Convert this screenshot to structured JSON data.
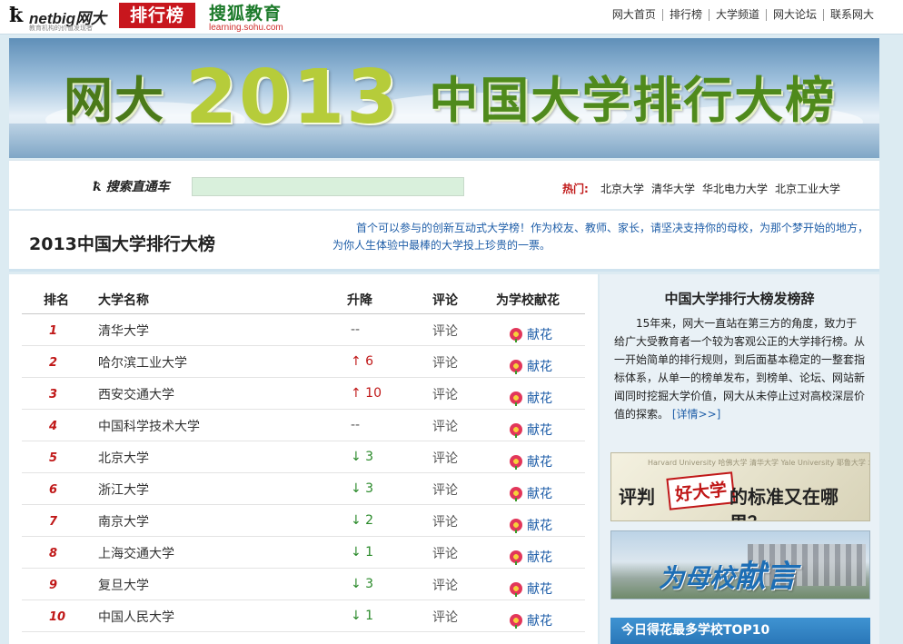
{
  "header": {
    "netbig_brand": "netbig网大",
    "netbig_slogan": "教育机构的价值发现者",
    "ranking_badge": "排行榜",
    "sohu_title": "搜狐教育",
    "sohu_url": "learning.sohu.com",
    "nav": [
      "网大首页",
      "排行榜",
      "大学频道",
      "网大论坛",
      "联系网大"
    ]
  },
  "banner": {
    "prefix": "网大",
    "year": "2013",
    "suffix": "中国大学排行大榜"
  },
  "search": {
    "label": "搜索直通车",
    "value": "",
    "hot_label": "热门:",
    "hot": [
      "北京大学",
      "清华大学",
      "华北电力大学",
      "北京工业大学"
    ]
  },
  "intro": {
    "title": "2013中国大学排行大榜",
    "text_line1": "首个可以参与的创新互动式大学榜！作为校友、教师、家长，请坚决支持你的母校，为那个梦开始的地方，",
    "text_line2": "为你人生体验中最棒的大学投上珍贵的一票。"
  },
  "table": {
    "headers": {
      "rank": "排名",
      "name": "大学名称",
      "move": "升降",
      "comment": "评论",
      "flower": "为学校献花"
    },
    "rows": [
      {
        "rank": "1",
        "name": "清华大学",
        "move": "--",
        "dir": "same",
        "comment": "评论",
        "flower": "献花"
      },
      {
        "rank": "2",
        "name": "哈尔滨工业大学",
        "move": "↑ 6",
        "dir": "up",
        "comment": "评论",
        "flower": "献花"
      },
      {
        "rank": "3",
        "name": "西安交通大学",
        "move": "↑ 10",
        "dir": "up",
        "comment": "评论",
        "flower": "献花"
      },
      {
        "rank": "4",
        "name": "中国科学技术大学",
        "move": "--",
        "dir": "same",
        "comment": "评论",
        "flower": "献花"
      },
      {
        "rank": "5",
        "name": "北京大学",
        "move": "↓ 3",
        "dir": "down",
        "comment": "评论",
        "flower": "献花"
      },
      {
        "rank": "6",
        "name": "浙江大学",
        "move": "↓ 3",
        "dir": "down",
        "comment": "评论",
        "flower": "献花"
      },
      {
        "rank": "7",
        "name": "南京大学",
        "move": "↓ 2",
        "dir": "down",
        "comment": "评论",
        "flower": "献花"
      },
      {
        "rank": "8",
        "name": "上海交通大学",
        "move": "↓ 1",
        "dir": "down",
        "comment": "评论",
        "flower": "献花"
      },
      {
        "rank": "9",
        "name": "复旦大学",
        "move": "↓ 3",
        "dir": "down",
        "comment": "评论",
        "flower": "献花"
      },
      {
        "rank": "10",
        "name": "中国人民大学",
        "move": "↓ 1",
        "dir": "down",
        "comment": "评论",
        "flower": "献花"
      }
    ]
  },
  "sidebar": {
    "title": "中国大学排行大榜发榜辞",
    "text": "15年来，网大一直站在第三方的角度，致力于给广大受教育者一个较为客观公正的大学排行榜。从一开始简单的排行规则，到后面基本稳定的一整套指标体系，从单一的榜单发布，到榜单、论坛、网站新闻同时挖掘大学价值，网大从未停止过对高校深层价值的探索。",
    "more": "[详情>>]",
    "ad1": {
      "left": "评判",
      "stamp": "好大学",
      "right": "的标准又在哪里？",
      "bg_text": "Harvard University 哈佛大学  清华大学  Yale University  耶鲁大学  北京大学"
    },
    "ad2": {
      "prefix": "为母校",
      "emphasis": "献言"
    },
    "top10": "今日得花最多学校TOP10"
  }
}
